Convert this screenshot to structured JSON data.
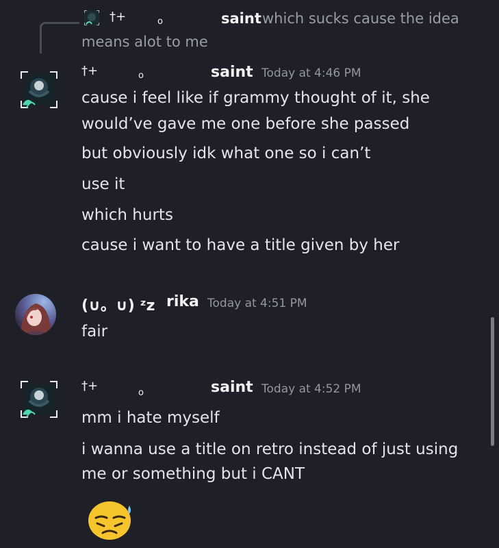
{
  "colors": {
    "background": "#1e1f27",
    "text": "#e4e5ea",
    "muted": "#9496a0",
    "emoji": "#f6c42c"
  },
  "reply_preview": {
    "deco_left": "†+",
    "deco_right": "o",
    "author": "saint",
    "text_line1": "which sucks cause the idea",
    "text_line2": "means alot to me"
  },
  "messages": [
    {
      "deco_left": "†+",
      "deco_right": "o",
      "author": "saint",
      "timestamp": "Today at 4:46 PM",
      "avatar_icon": "anime-avatar-frame-icon",
      "lines": [
        "cause i feel like if grammy thought of it, she",
        "would’ve gave me one before she passed",
        "but obviously idk what one so i can’t",
        "use it",
        "which hurts",
        "cause i want to have a title given by her"
      ]
    },
    {
      "deco_left": "(∪。∪) ᶻz",
      "author": "rika",
      "timestamp": "Today at 4:51 PM",
      "avatar_icon": "rika-avatar-icon",
      "lines": [
        "fair"
      ]
    },
    {
      "deco_left": "†+",
      "deco_right": "o",
      "author": "saint",
      "timestamp": "Today at 4:52 PM",
      "avatar_icon": "anime-avatar-frame-icon",
      "lines": [
        "mm i hate myself",
        "i wanna use a title on retro instead of just using",
        "me or something but i CANT"
      ],
      "emoji": "pensive-sweat-emoji-icon"
    }
  ]
}
